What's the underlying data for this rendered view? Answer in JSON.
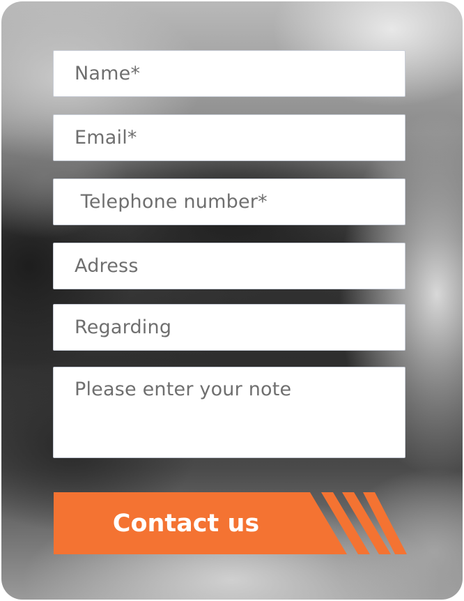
{
  "form": {
    "fields": [
      {
        "placeholder": "Name*"
      },
      {
        "placeholder": "Email*"
      },
      {
        "placeholder": " Telephone number*"
      },
      {
        "placeholder": "Adress"
      },
      {
        "placeholder": "Regarding"
      },
      {
        "placeholder": "Please enter your note"
      }
    ],
    "submit_label": "Contact us"
  },
  "colors": {
    "accent": "#f47332",
    "field_bg": "#ffffff",
    "placeholder_text": "#6f6f6f"
  }
}
